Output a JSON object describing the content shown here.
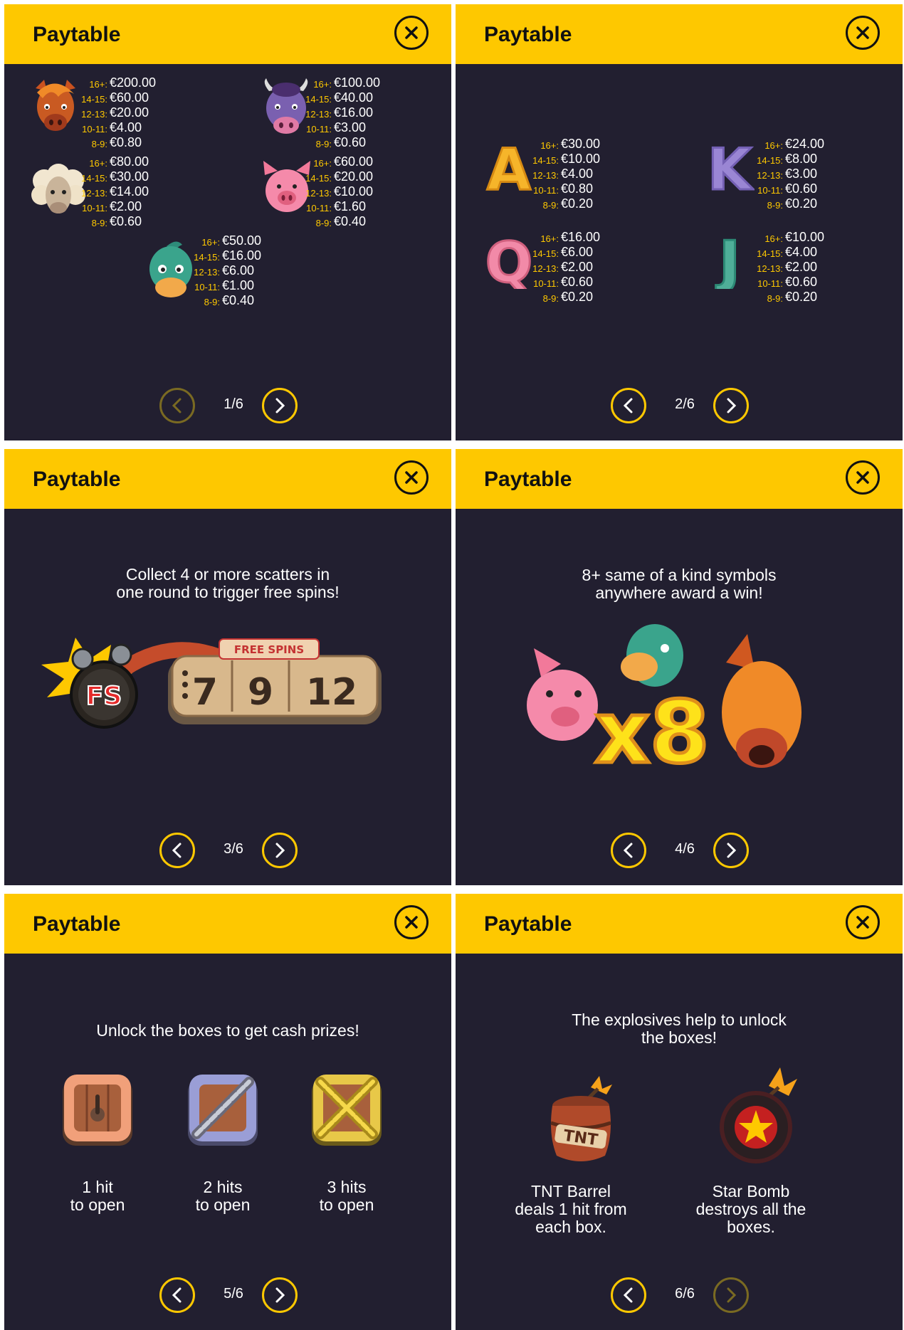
{
  "panels": [
    {
      "title": "Paytable",
      "page": "1/6",
      "symbols": [
        {
          "name": "Horse",
          "pays": [
            {
              "count": "16+:",
              "value": "€200.00"
            },
            {
              "count": "14-15:",
              "value": "€60.00"
            },
            {
              "count": "12-13:",
              "value": "€20.00"
            },
            {
              "count": "10-11:",
              "value": "€4.00"
            },
            {
              "count": "8-9:",
              "value": "€0.80"
            }
          ]
        },
        {
          "name": "Buffalo",
          "pays": [
            {
              "count": "16+:",
              "value": "€100.00"
            },
            {
              "count": "14-15:",
              "value": "€40.00"
            },
            {
              "count": "12-13:",
              "value": "€16.00"
            },
            {
              "count": "10-11:",
              "value": "€3.00"
            },
            {
              "count": "8-9:",
              "value": "€0.60"
            }
          ]
        },
        {
          "name": "Sheep",
          "pays": [
            {
              "count": "16+:",
              "value": "€80.00"
            },
            {
              "count": "14-15:",
              "value": "€30.00"
            },
            {
              "count": "12-13:",
              "value": "€14.00"
            },
            {
              "count": "10-11:",
              "value": "€2.00"
            },
            {
              "count": "8-9:",
              "value": "€0.60"
            }
          ]
        },
        {
          "name": "Pig",
          "pays": [
            {
              "count": "16+:",
              "value": "€60.00"
            },
            {
              "count": "14-15:",
              "value": "€20.00"
            },
            {
              "count": "12-13:",
              "value": "€10.00"
            },
            {
              "count": "10-11:",
              "value": "€1.60"
            },
            {
              "count": "8-9:",
              "value": "€0.40"
            }
          ]
        },
        {
          "name": "Duck",
          "pays": [
            {
              "count": "16+:",
              "value": "€50.00"
            },
            {
              "count": "14-15:",
              "value": "€16.00"
            },
            {
              "count": "12-13:",
              "value": "€6.00"
            },
            {
              "count": "10-11:",
              "value": "€1.00"
            },
            {
              "count": "8-9:",
              "value": "€0.40"
            }
          ]
        }
      ]
    },
    {
      "title": "Paytable",
      "page": "2/6",
      "symbols": [
        {
          "name": "A",
          "pays": [
            {
              "count": "16+:",
              "value": "€30.00"
            },
            {
              "count": "14-15:",
              "value": "€10.00"
            },
            {
              "count": "12-13:",
              "value": "€4.00"
            },
            {
              "count": "10-11:",
              "value": "€0.80"
            },
            {
              "count": "8-9:",
              "value": "€0.20"
            }
          ]
        },
        {
          "name": "K",
          "pays": [
            {
              "count": "16+:",
              "value": "€24.00"
            },
            {
              "count": "14-15:",
              "value": "€8.00"
            },
            {
              "count": "12-13:",
              "value": "€3.00"
            },
            {
              "count": "10-11:",
              "value": "€0.60"
            },
            {
              "count": "8-9:",
              "value": "€0.20"
            }
          ]
        },
        {
          "name": "Q",
          "pays": [
            {
              "count": "16+:",
              "value": "€16.00"
            },
            {
              "count": "14-15:",
              "value": "€6.00"
            },
            {
              "count": "12-13:",
              "value": "€2.00"
            },
            {
              "count": "10-11:",
              "value": "€0.60"
            },
            {
              "count": "8-9:",
              "value": "€0.20"
            }
          ]
        },
        {
          "name": "J",
          "pays": [
            {
              "count": "16+:",
              "value": "€10.00"
            },
            {
              "count": "14-15:",
              "value": "€4.00"
            },
            {
              "count": "12-13:",
              "value": "€2.00"
            },
            {
              "count": "10-11:",
              "value": "€0.60"
            },
            {
              "count": "8-9:",
              "value": "€0.20"
            }
          ]
        }
      ]
    },
    {
      "title": "Paytable",
      "page": "3/6",
      "text": "Collect 4 or more scatters in one round to trigger free spins!",
      "badge": "FREE SPINS",
      "fs_label": "FS",
      "spins": [
        "7",
        "9",
        "12"
      ]
    },
    {
      "title": "Paytable",
      "page": "4/6",
      "text": "8+ same of a kind symbols anywhere award a win!",
      "multiplier": "x8"
    },
    {
      "title": "Paytable",
      "page": "5/6",
      "text": "Unlock the boxes to get cash prizes!",
      "boxes": [
        {
          "line1": "1 hit",
          "line2": "to open"
        },
        {
          "line1": "2 hits",
          "line2": "to open"
        },
        {
          "line1": "3 hits",
          "line2": "to open"
        }
      ]
    },
    {
      "title": "Paytable",
      "page": "6/6",
      "text": "The explosives help to unlock the boxes!",
      "tnt_label": "TNT",
      "explosives": [
        {
          "caption": "TNT Barrel deals 1 hit from each box."
        },
        {
          "caption": "Star Bomb destroys all the boxes."
        }
      ]
    }
  ],
  "colors": {
    "accent": "#fec800",
    "background": "#221f30",
    "header_text": "#111111"
  },
  "icons": [
    "close-icon",
    "chevron-left-icon",
    "chevron-right-icon"
  ]
}
